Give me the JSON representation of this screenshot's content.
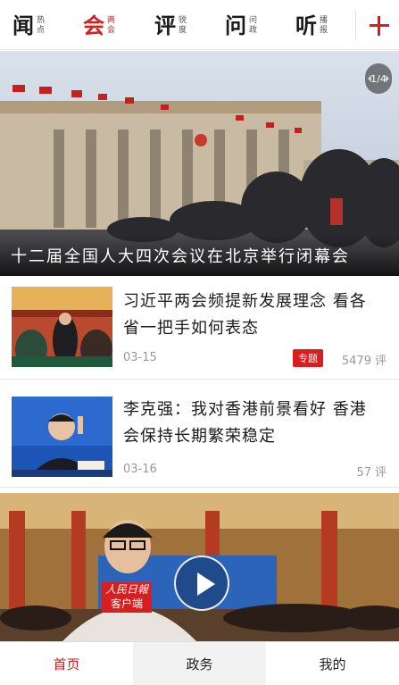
{
  "nav": {
    "items": [
      {
        "big": "闻",
        "sub1": "热",
        "sub2": "点"
      },
      {
        "big": "会",
        "sub1": "两",
        "sub2": "会"
      },
      {
        "big": "评",
        "sub1": "锐",
        "sub2": "度"
      },
      {
        "big": "问",
        "sub1": "问",
        "sub2": "政"
      },
      {
        "big": "听",
        "sub1": "播",
        "sub2": "报"
      }
    ],
    "active_index": 1,
    "add_icon": "plus-icon",
    "accent": "#d81e1e"
  },
  "hero": {
    "caption": "十二届全国人大四次会议在北京举行闭幕会",
    "page_indicator": "1/4"
  },
  "articles": [
    {
      "title": "习近平两会频提新发展理念 看各省一把手如何表态",
      "date": "03-15",
      "tag": "专题",
      "comments": "5479",
      "comments_unit": "评"
    },
    {
      "title": "李克强：我对香港前景看好 香港会保持长期繁荣稳定",
      "date": "03-16",
      "tag": "",
      "comments": "57",
      "comments_unit": "评"
    }
  ],
  "video": {
    "logo_line1": "人民日報",
    "logo_line2": "客户端",
    "play_icon": "play-icon"
  },
  "tabbar": {
    "tabs": [
      {
        "label": "首页"
      },
      {
        "label": "政务"
      },
      {
        "label": "我的"
      }
    ],
    "active_index": 0
  }
}
